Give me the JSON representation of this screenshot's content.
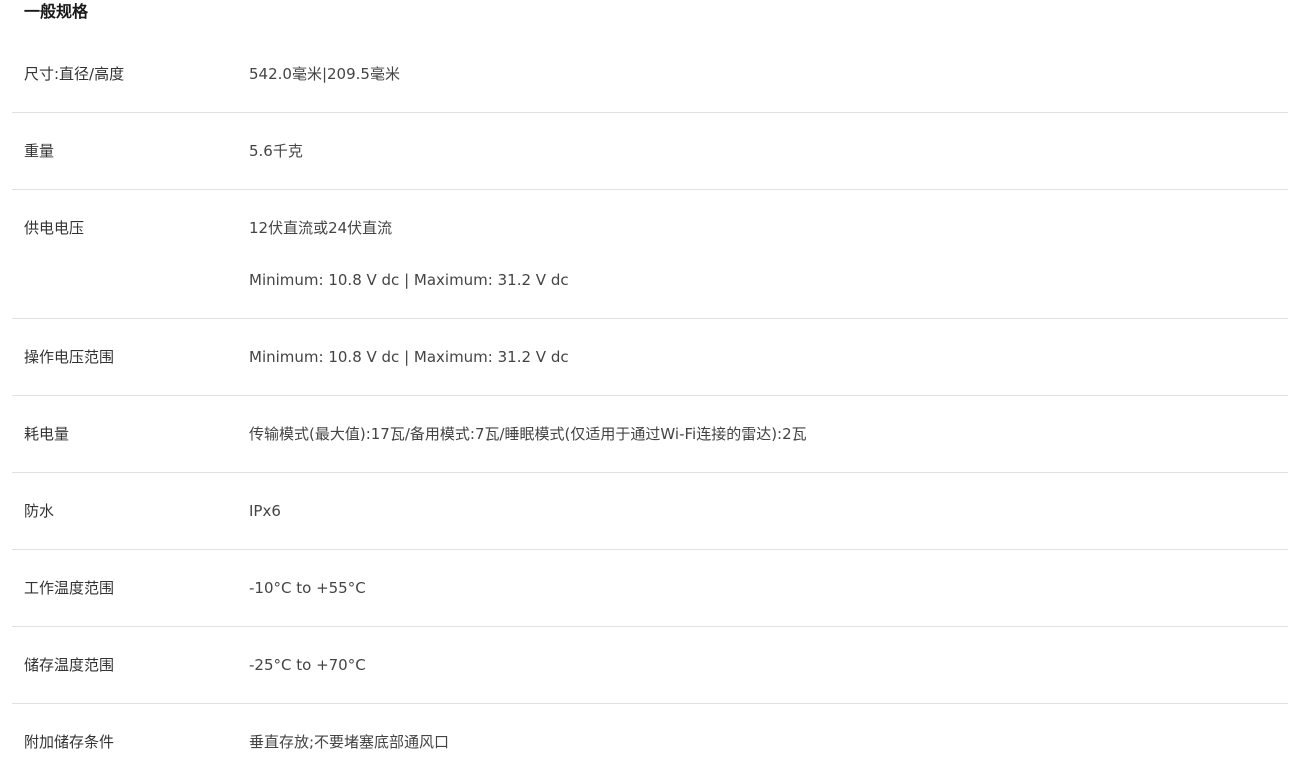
{
  "section": {
    "title": "一般规格"
  },
  "rows": [
    {
      "label": "尺寸:直径/高度",
      "values": [
        "542.0毫米|209.5毫米"
      ]
    },
    {
      "label": "重量",
      "values": [
        "5.6千克"
      ]
    },
    {
      "label": "供电电压",
      "values": [
        "12伏直流或24伏直流",
        "Minimum: 10.8 V dc | Maximum: 31.2 V dc"
      ]
    },
    {
      "label": "操作电压范围",
      "values": [
        "Minimum: 10.8 V dc | Maximum: 31.2 V dc"
      ]
    },
    {
      "label": "耗电量",
      "values": [
        "传输模式(最大值):17瓦/备用模式:7瓦/睡眠模式(仅适用于通过Wi-Fi连接的雷达):2瓦"
      ]
    },
    {
      "label": "防水",
      "values": [
        "IPx6"
      ]
    },
    {
      "label": "工作温度范围",
      "values": [
        "-10°C to +55°C"
      ]
    },
    {
      "label": "储存温度范围",
      "values": [
        "-25°C to +70°C"
      ]
    },
    {
      "label": "附加储存条件",
      "values": [
        "垂直存放;不要堵塞底部通风口"
      ]
    }
  ]
}
